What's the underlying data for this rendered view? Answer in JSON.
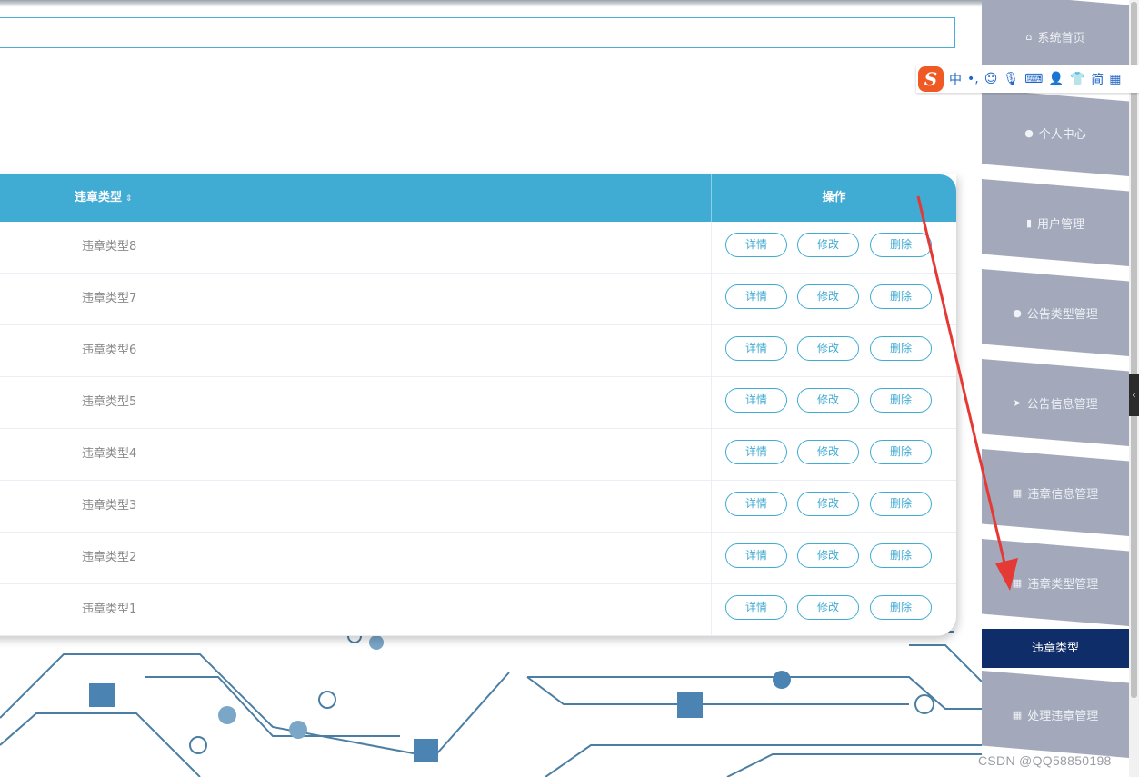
{
  "header": {
    "search_value": ""
  },
  "table": {
    "columns": {
      "type": "违章类型",
      "sort_icon": "⇕",
      "ops": "操作"
    },
    "rows": [
      {
        "type": "违章类型8"
      },
      {
        "type": "违章类型7"
      },
      {
        "type": "违章类型6"
      },
      {
        "type": "违章类型5"
      },
      {
        "type": "违章类型4"
      },
      {
        "type": "违章类型3"
      },
      {
        "type": "违章类型2"
      },
      {
        "type": "违章类型1"
      }
    ],
    "actions": {
      "detail": "详情",
      "edit": "修改",
      "delete": "删除"
    }
  },
  "sidebar": {
    "items": [
      {
        "label": "系统首页",
        "icon": "home-icon"
      },
      {
        "label": "个人中心",
        "icon": "user-icon"
      },
      {
        "label": "用户管理",
        "icon": "clipboard-icon"
      },
      {
        "label": "公告类型管理",
        "icon": "user-icon"
      },
      {
        "label": "公告信息管理",
        "icon": "send-icon"
      },
      {
        "label": "违章信息管理",
        "icon": "grid-icon"
      },
      {
        "label": "违章类型管理",
        "icon": "grid-icon"
      },
      {
        "label": "处理违章管理",
        "icon": "grid-icon"
      }
    ],
    "active_sub": "违章类型"
  },
  "ime": {
    "logo": "S",
    "mode": "中",
    "punct": "•,",
    "simplified": "简"
  },
  "watermark": "CSDN @QQ58850198",
  "colors": {
    "accent": "#40abd3",
    "sidebar": "#a3a9bb",
    "active": "#0f2d69",
    "arrow": "#e53935"
  }
}
